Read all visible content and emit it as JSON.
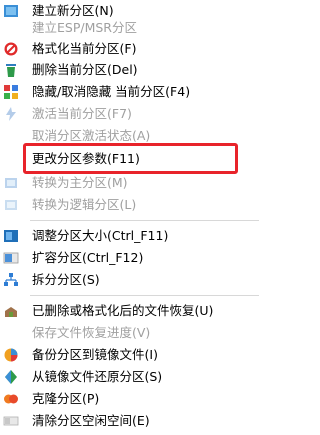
{
  "menu": {
    "items": [
      {
        "label": "建立新分区(N)",
        "icon": "new-partition-icon",
        "disabled": false
      },
      {
        "label": "建立ESP/MSR分区",
        "icon": "",
        "disabled": true
      },
      {
        "label": "格式化当前分区(F)",
        "icon": "format-icon",
        "disabled": false
      },
      {
        "label": "删除当前分区(Del)",
        "icon": "delete-icon",
        "disabled": false
      },
      {
        "label": "隐藏/取消隐藏 当前分区(F4)",
        "icon": "hide-icon",
        "disabled": false
      },
      {
        "label": "激活当前分区(F7)",
        "icon": "activate-icon",
        "disabled": true
      },
      {
        "label": "取消分区激活状态(A)",
        "icon": "",
        "disabled": true
      },
      {
        "label": "更改分区参数(F11)",
        "icon": "",
        "disabled": false
      },
      {
        "label": "转换为主分区(M)",
        "icon": "convert-primary-icon",
        "disabled": true
      },
      {
        "label": "转换为逻辑分区(L)",
        "icon": "convert-logical-icon",
        "disabled": true
      },
      {
        "label": "调整分区大小(Ctrl_F11)",
        "icon": "resize-icon",
        "disabled": false
      },
      {
        "label": "扩容分区(Ctrl_F12)",
        "icon": "extend-icon",
        "disabled": false
      },
      {
        "label": "拆分分区(S)",
        "icon": "split-icon",
        "disabled": false
      },
      {
        "label": "已删除或格式化后的文件恢复(U)",
        "icon": "recover-icon",
        "disabled": false
      },
      {
        "label": "保存文件恢复进度(V)",
        "icon": "",
        "disabled": true
      },
      {
        "label": "备份分区到镜像文件(I)",
        "icon": "backup-icon",
        "disabled": false
      },
      {
        "label": "从镜像文件还原分区(S)",
        "icon": "restore-icon",
        "disabled": false
      },
      {
        "label": "克隆分区(P)",
        "icon": "clone-icon",
        "disabled": false
      },
      {
        "label": "清除分区空闲空间(E)",
        "icon": "wipe-icon",
        "disabled": false
      }
    ]
  },
  "colors": {
    "highlight": "#e8232a",
    "disabled_text": "#a0a0a0"
  }
}
